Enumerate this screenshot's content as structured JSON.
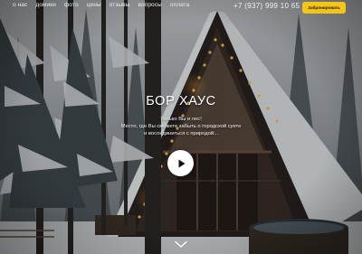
{
  "nav": {
    "links": [
      "о нас",
      "домики",
      "фото",
      "цены",
      "отзывы",
      "вопросы",
      "оплата"
    ],
    "phone": "+7 (937) 999 10 65",
    "book_label": "Забронировать"
  },
  "hero": {
    "title": "БОР ХАУС",
    "subtitle_lines": [
      "Только Вы и лес!",
      "Место, где Вы сможете забыть о городской суете",
      "и восоединиться с природой..."
    ]
  },
  "icons": {
    "play": "play-icon",
    "scroll": "chevron-down-icon"
  },
  "colors": {
    "accent": "#f4c519",
    "text": "#ffffff",
    "lights": "#ffb23c"
  }
}
